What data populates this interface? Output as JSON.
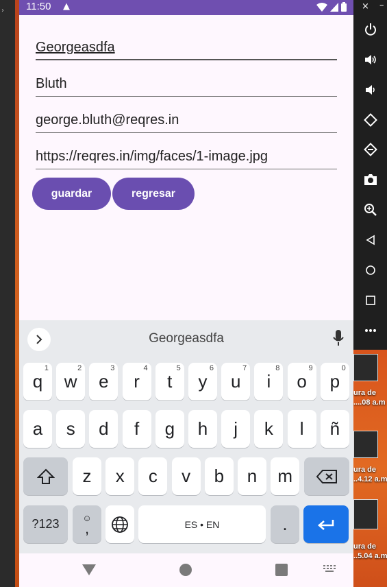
{
  "status": {
    "time": "11:50"
  },
  "form": {
    "first_name": "Georgeasdfa",
    "last_name": "Bluth",
    "email": "george.bluth@reqres.in",
    "avatar_url": "https://reqres.in/img/faces/1-image.jpg"
  },
  "buttons": {
    "save": "guardar",
    "back": "regresar"
  },
  "keyboard": {
    "suggestion": "Georgeasdfa",
    "row1": [
      [
        "q",
        "1"
      ],
      [
        "w",
        "2"
      ],
      [
        "e",
        "3"
      ],
      [
        "r",
        "4"
      ],
      [
        "t",
        "5"
      ],
      [
        "y",
        "6"
      ],
      [
        "u",
        "7"
      ],
      [
        "i",
        "8"
      ],
      [
        "o",
        "9"
      ],
      [
        "p",
        "0"
      ]
    ],
    "row2": [
      "a",
      "s",
      "d",
      "f",
      "g",
      "h",
      "j",
      "k",
      "l",
      "ñ"
    ],
    "row3": [
      "z",
      "x",
      "c",
      "v",
      "b",
      "n",
      "m"
    ],
    "symbols_label": "?123",
    "emoji_label": ",",
    "space_label": "ES • EN",
    "period_label": "."
  },
  "desktop": {
    "items": [
      {
        "label_line1": "ura de",
        "label_line2": "....08 a.m"
      },
      {
        "label_line1": "ura de",
        "label_line2": "..4.12 a.m"
      },
      {
        "label_line1": "ura de",
        "label_line2": "..5.04 a.m"
      }
    ]
  },
  "colors": {
    "accent": "#6a4eb0",
    "statusbar": "#6f4fb0",
    "enter_key": "#1a73e8"
  }
}
